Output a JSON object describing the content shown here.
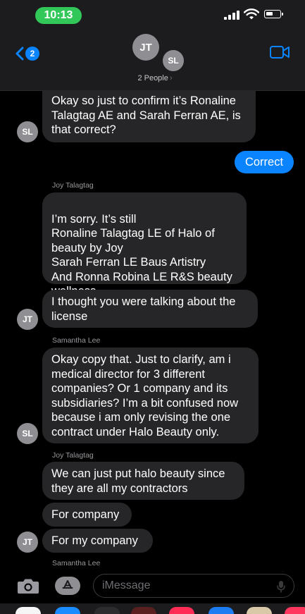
{
  "status_bar": {
    "time": "10:13"
  },
  "header": {
    "back_badge": "2",
    "avatars": [
      {
        "initials": "JT"
      },
      {
        "initials": "SL"
      }
    ],
    "people_label": "2 People",
    "people_chevron": "›"
  },
  "messages": [
    {
      "direction": "in",
      "avatar": "SL",
      "text": "Okay so just to confirm it’s Ronaline Talagtag AE and Sarah Ferran AE, is that correct?"
    },
    {
      "direction": "out",
      "text": "Correct"
    },
    {
      "direction": "in",
      "sender": "Joy Talagtag",
      "text": "I’m sorry. It’s still\nRonaline Talagtag LE of Halo of beauty by Joy\nSarah Ferran LE Baus Artistry\nAnd Ronna Robina LE R&S beauty wellness"
    },
    {
      "direction": "in",
      "avatar": "JT",
      "text": "I thought you were talking about the license"
    },
    {
      "direction": "in",
      "sender": "Samantha Lee",
      "avatar": "SL",
      "text": "Okay copy that. Just to clarify, am i medical director for 3 different companies? Or 1 company and its subsidiaries? I’m a bit confused now because i am only revising the one contract under Halo Beauty only."
    },
    {
      "direction": "in",
      "sender": "Joy Talagtag",
      "text": "We can just put halo beauty since they are all my contractors"
    },
    {
      "direction": "in",
      "text": "For company"
    },
    {
      "direction": "in",
      "avatar": "JT",
      "text": "For my company"
    },
    {
      "direction": "in",
      "sender": "Samantha Lee",
      "text": ""
    }
  ],
  "input_bar": {
    "placeholder": "iMessage"
  },
  "colors": {
    "accent": "#0a84ff",
    "time_pill": "#32c759",
    "incoming_bubble": "#262628",
    "background": "#000000"
  },
  "icons": [
    "signal-icon",
    "wifi-icon",
    "battery-icon",
    "back-chevron-icon",
    "video-camera-icon",
    "camera-icon",
    "app-store-icon",
    "microphone-icon"
  ]
}
